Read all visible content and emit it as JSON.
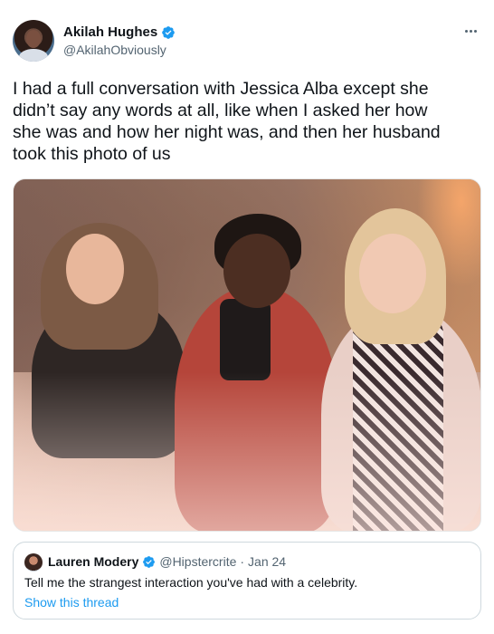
{
  "author": {
    "name": "Akilah Hughes",
    "handle": "@AkilahObviously",
    "verified": true,
    "avatar_icon": "user-avatar"
  },
  "tweet": {
    "text": "I had a full conversation with Jessica Alba except she\ndidn’t say any words at all, like when I asked her how\nshe was and how her night was, and then her husband\ntook this photo of us",
    "more_icon": "more-horizontal-icon"
  },
  "photo": {
    "subject": "three people seated together indoors"
  },
  "quote": {
    "name": "Lauren Modery",
    "handle": "@Hipstercrite",
    "separator": "·",
    "date": "Jan 24",
    "verified": true,
    "text": "Tell me the strangest interaction you've had with a celebrity.",
    "thread_link": "Show this thread"
  },
  "colors": {
    "verified": "#1d9bf0",
    "link": "#1d9bf0",
    "secondary_text": "#536471",
    "primary_text": "#0f1419",
    "border": "#cfd9de"
  }
}
